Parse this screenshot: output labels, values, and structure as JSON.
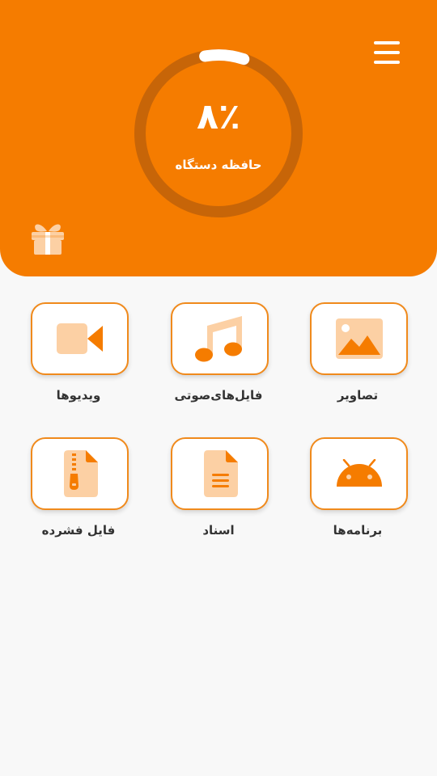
{
  "header": {
    "storage_percent": 8,
    "storage_value_text": "۸٪",
    "storage_label": "حافظه دستگاه",
    "menu_icon": "hamburger-menu-icon",
    "gift_icon": "gift-icon"
  },
  "colors": {
    "accent": "#f57c00",
    "accent_light": "#fcd0a4",
    "background": "#f8f8f8",
    "ring_track": "#c76508"
  },
  "categories": [
    {
      "label": "تصاویر",
      "icon": "image-icon"
    },
    {
      "label": "فایل‌های‌صوتی",
      "icon": "music-icon"
    },
    {
      "label": "ویدیوها",
      "icon": "video-camera-icon"
    },
    {
      "label": "برنامه‌ها",
      "icon": "android-icon"
    },
    {
      "label": "اسناد",
      "icon": "document-icon"
    },
    {
      "label": "فایل فشرده",
      "icon": "zip-file-icon"
    }
  ]
}
